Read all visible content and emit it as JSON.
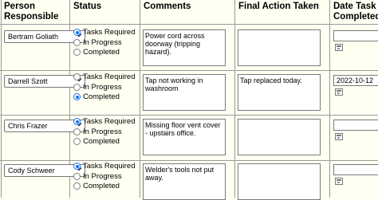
{
  "headers": {
    "person": "Person Responsible",
    "status": "Status",
    "comments": "Comments",
    "final_action": "Final Action Taken",
    "date_completed": "Date Task Completed"
  },
  "status_options": [
    "Tasks Required",
    "In Progress",
    "Completed"
  ],
  "rows": [
    {
      "person": "Bertram Goliath",
      "status": "Tasks Required",
      "comments": "Power cord across doorway (tripping hazard).",
      "final_action": "",
      "date": ""
    },
    {
      "person": "Darrell Szott",
      "status": "Completed",
      "comments": "Tap not working in washroom",
      "final_action": "Tap replaced today.",
      "date": "2022-10-12"
    },
    {
      "person": "Chris Frazer",
      "status": "Tasks Required",
      "comments": "Missing floor vent cover - upstairs office.",
      "final_action": "",
      "date": ""
    },
    {
      "person": "Cody Schweer",
      "status": "Tasks Required",
      "comments": "Welder's tools not put away.",
      "final_action": "",
      "date": ""
    }
  ],
  "icons": {
    "dropdown": "chevron-down-icon",
    "calendar": "calendar-icon"
  }
}
